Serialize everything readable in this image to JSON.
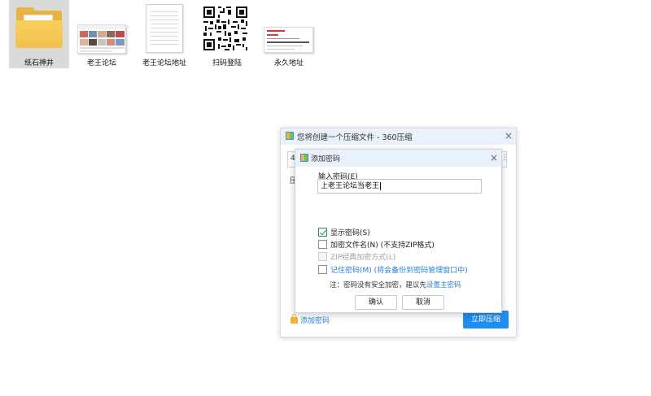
{
  "desktop": {
    "icons": [
      {
        "label": "纸石神井",
        "kind": "folder",
        "icon": "folder-icon",
        "selected": true
      },
      {
        "label": "老王论坛",
        "kind": "image",
        "icon": "image-thumbnail-icon"
      },
      {
        "label": "老王论坛地址",
        "kind": "document",
        "icon": "text-document-icon"
      },
      {
        "label": "扫码登陆",
        "kind": "qrcode",
        "icon": "qr-code-icon"
      },
      {
        "label": "永久地址",
        "kind": "image",
        "icon": "image-thumbnail-icon"
      }
    ]
  },
  "main_dialog": {
    "title": "您将创建一个压缩文件 - 360压缩",
    "close_glyph": "×",
    "behind_label_1": "4",
    "behind_label_2": "压",
    "behind_glyph": "⋮",
    "add_password_link": "添加密码",
    "compress_now_button": "立即压缩",
    "accent_color": "#1e8ff0"
  },
  "password_dialog": {
    "title": "添加密码",
    "close_glyph": "×",
    "input_label": "输入密码(E)",
    "password_value": "上老王论坛当老王",
    "options": [
      {
        "label": "显示密码(S)",
        "checked": true,
        "disabled": false,
        "style": "normal"
      },
      {
        "label": "加密文件名(N) (不支持ZIP格式)",
        "checked": false,
        "disabled": false,
        "style": "normal"
      },
      {
        "label": "ZIP经典加密方式(L)",
        "checked": false,
        "disabled": true,
        "style": "disabled"
      },
      {
        "label": "记住密码(M) (将会备份到密码管理窗口中)",
        "checked": false,
        "disabled": false,
        "style": "blue"
      }
    ],
    "note_text": "注：密码没有安全加密，建议先",
    "note_link": "设置主密码",
    "confirm_button": "确认",
    "cancel_button": "取消"
  }
}
